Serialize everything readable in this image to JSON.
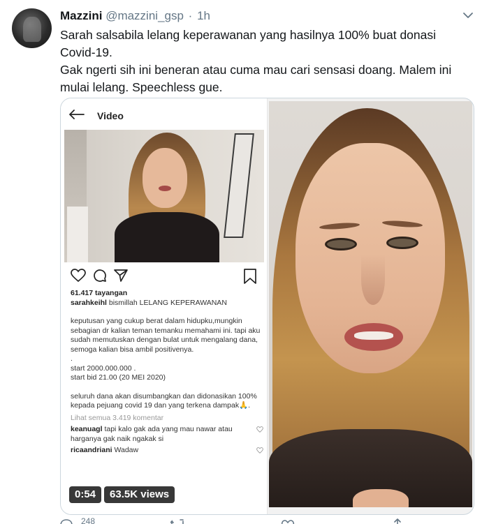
{
  "tweet": {
    "author_name": "Mazzini",
    "author_handle": "@mazzini_gsp",
    "separator": "·",
    "time": "1h",
    "text_line1": "Sarah salsabila lelang keperawanan yang hasilnya 100% buat donasi Covid-19.",
    "text_line2": "Gak ngerti sih ini beneran atau cuma mau cari sensasi doang. Malem ini mulai lelang. Speechless gue."
  },
  "media": {
    "duration": "0:54",
    "views": "63.5K views"
  },
  "instagram": {
    "title": "Video",
    "views": "61.417 tayangan",
    "username": "sarahkeihl",
    "caption_first": "bismillah LELANG KEPERAWANAN",
    "para1": "keputusan yang cukup berat dalam hidupku,mungkin sebagian dr kalian teman temanku memahami ini. tapi aku sudah memutuskan dengan bulat untuk mengalang dana, semoga kalian bisa ambil positivenya.",
    "dot": ".",
    "start": "start 2000.000.000 .",
    "start_bid": "start bid 21.00 (20 MEI 2020)",
    "para2": "seluruh dana akan disumbangkan dan didonasikan 100% kepada pejuang covid 19 dan yang terkena dampak🙏.",
    "view_comments": "Lihat semua 3.419 komentar",
    "comment1_user": "keanuagl",
    "comment1_text": "tapi kalo gak ada yang mau nawar atau harganya gak naik ngakak si",
    "comment2_user": "ricaandriani",
    "comment2_text": "Wadaw"
  },
  "footer": {
    "reply_count": "248"
  }
}
